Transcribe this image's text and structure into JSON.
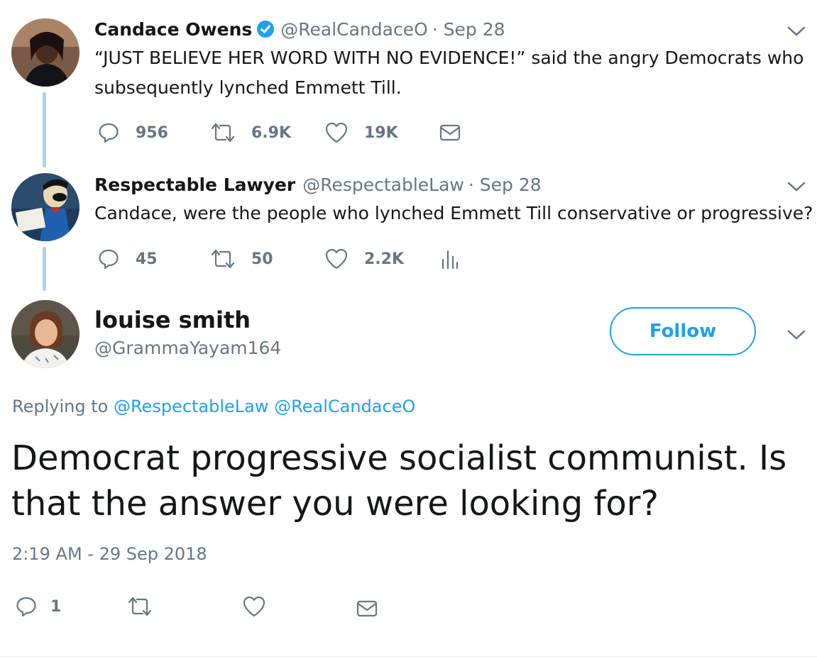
{
  "colors": {
    "accent": "#1da1f2",
    "muted": "#657786",
    "text": "#14171a",
    "thread": "#a8d4f5"
  },
  "tweets": [
    {
      "name": "Candace Owens",
      "verified": true,
      "handle": "@RealCandaceO",
      "date": "· Sep 28",
      "text_line1": "“JUST BELIEVE HER WORD WITH NO EVIDENCE!” said the angry Democrats who",
      "text_line2": "subsequently lynched Emmett Till.",
      "replies": "956",
      "retweets": "6.9K",
      "likes": "19K",
      "extra_icon": "mail-icon"
    },
    {
      "name": "Respectable Lawyer",
      "handle": "@RespectableLaw",
      "date": "· Sep 28",
      "text_line1": "Candace, were the people who lynched Emmett Till conservative or progressive?",
      "replies": "45",
      "retweets": "50",
      "likes": "2.2K",
      "extra_icon": "analytics-icon"
    }
  ],
  "main_tweet": {
    "name": "louise smith",
    "handle": "@GrammaYayam164",
    "follow_label": "Follow",
    "replying_prefix": "Replying to",
    "replying_to": [
      "@RespectableLaw",
      "@RealCandaceO"
    ],
    "text_line1": "Democrat progressive socialist communist. Is",
    "text_line2": "that the answer you were looking for?",
    "timestamp": "2:19 AM - 29 Sep 2018",
    "replies": "1"
  }
}
